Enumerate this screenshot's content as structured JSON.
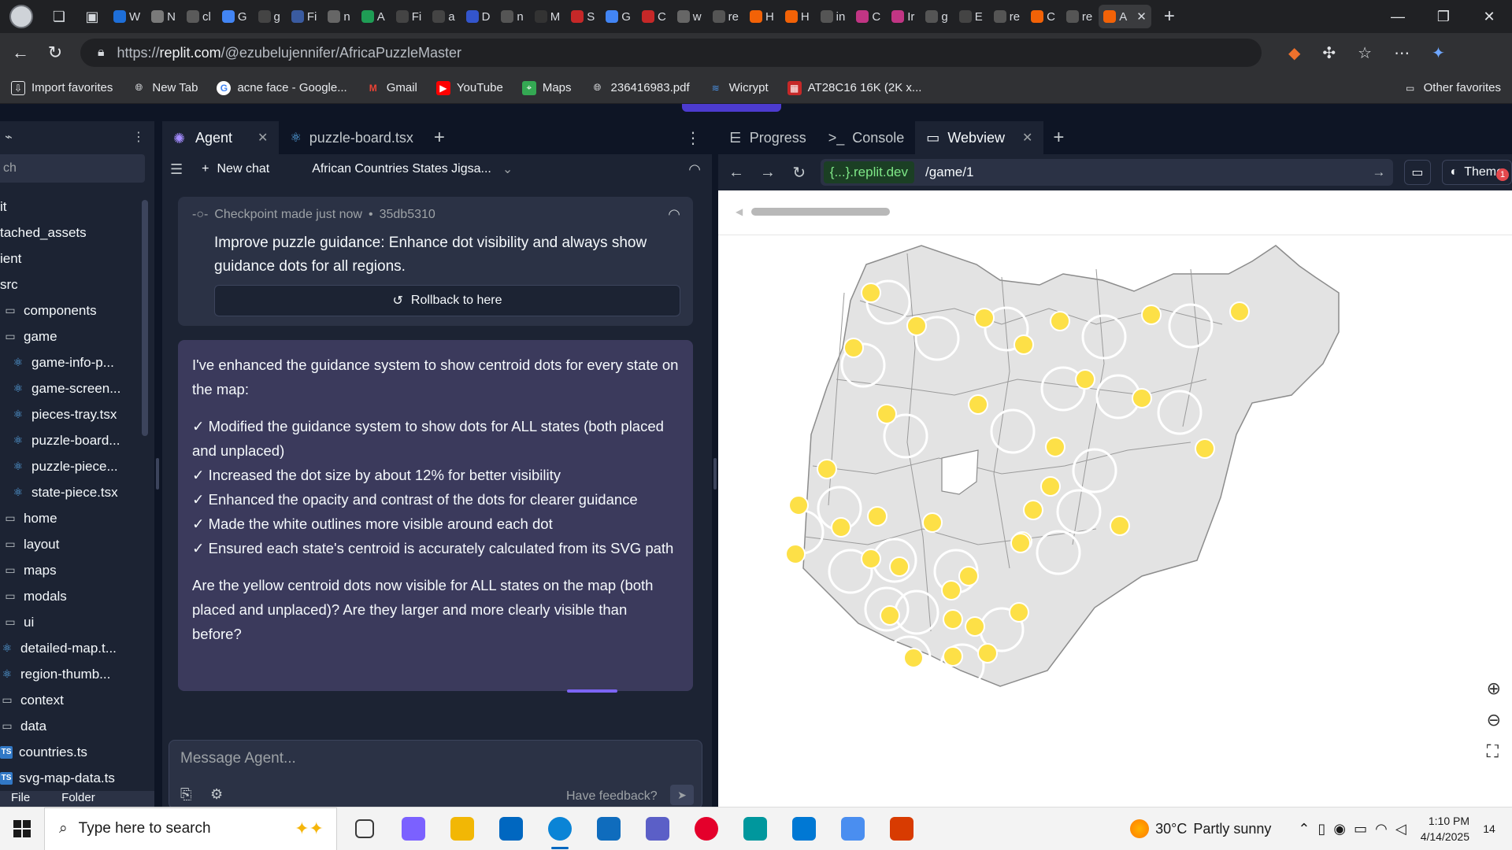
{
  "browser": {
    "url_prefix": "https://",
    "url_host": "replit.com",
    "url_path": "/@ezubelujennifer/AfricaPuzzleMaster",
    "tabs": [
      {
        "label": "W",
        "color": "#1e6fd9"
      },
      {
        "label": "N",
        "color": "#7a7a7a"
      },
      {
        "label": "cl",
        "color": "#5a5a5a"
      },
      {
        "label": "G",
        "color": "#4285f4"
      },
      {
        "label": "g",
        "color": "#444444"
      },
      {
        "label": "Fi",
        "color": "#3a5ba0"
      },
      {
        "label": "n",
        "color": "#666666"
      },
      {
        "label": "A",
        "color": "#1f9d55"
      },
      {
        "label": "Fi",
        "color": "#444444"
      },
      {
        "label": "a",
        "color": "#444444"
      },
      {
        "label": "D",
        "color": "#3355cc"
      },
      {
        "label": "n",
        "color": "#555555"
      },
      {
        "label": "M",
        "color": "#333333"
      },
      {
        "label": "S",
        "color": "#c62828"
      },
      {
        "label": "G",
        "color": "#4285f4"
      },
      {
        "label": "C",
        "color": "#c62828"
      },
      {
        "label": "w",
        "color": "#666666"
      },
      {
        "label": "re",
        "color": "#555555"
      },
      {
        "label": "H",
        "color": "#f26207"
      },
      {
        "label": "H",
        "color": "#f26207"
      },
      {
        "label": "in",
        "color": "#555555"
      },
      {
        "label": "C",
        "color": "#c13584"
      },
      {
        "label": "Ir",
        "color": "#c13584"
      },
      {
        "label": "g",
        "color": "#555555"
      },
      {
        "label": "E",
        "color": "#444444"
      },
      {
        "label": "re",
        "color": "#555555"
      },
      {
        "label": "C",
        "color": "#f26207"
      },
      {
        "label": "re",
        "color": "#555555"
      },
      {
        "label": "A",
        "color": "#f26207"
      }
    ],
    "favorites": [
      {
        "label": "Import favorites",
        "icon": "import-icon"
      },
      {
        "label": "New Tab",
        "icon": "globe-icon"
      },
      {
        "label": "acne face - Google...",
        "icon": "google-icon"
      },
      {
        "label": "Gmail",
        "icon": "gmail-icon"
      },
      {
        "label": "YouTube",
        "icon": "youtube-icon"
      },
      {
        "label": "Maps",
        "icon": "maps-icon"
      },
      {
        "label": "236416983.pdf",
        "icon": "globe-icon"
      },
      {
        "label": "Wicrypt",
        "icon": "wicrypt-icon"
      },
      {
        "label": "AT28C16 16K (2K x...",
        "icon": "site-icon"
      }
    ],
    "other_favorites": "Other favorites"
  },
  "filetree": {
    "search_placeholder": "ch",
    "items": [
      {
        "label": "it",
        "type": "file"
      },
      {
        "label": "tached_assets",
        "type": "file"
      },
      {
        "label": "ient",
        "type": "file"
      },
      {
        "label": "src",
        "type": "file"
      },
      {
        "label": "components",
        "type": "folder"
      },
      {
        "label": "game",
        "type": "folder"
      },
      {
        "label": "game-info-p...",
        "type": "react"
      },
      {
        "label": "game-screen...",
        "type": "react"
      },
      {
        "label": "pieces-tray.tsx",
        "type": "react"
      },
      {
        "label": "puzzle-board...",
        "type": "react"
      },
      {
        "label": "puzzle-piece...",
        "type": "react"
      },
      {
        "label": "state-piece.tsx",
        "type": "react"
      },
      {
        "label": "home",
        "type": "folder"
      },
      {
        "label": "layout",
        "type": "folder"
      },
      {
        "label": "maps",
        "type": "folder"
      },
      {
        "label": "modals",
        "type": "folder"
      },
      {
        "label": "ui",
        "type": "folder"
      },
      {
        "label": "detailed-map.t...",
        "type": "react"
      },
      {
        "label": "region-thumb...",
        "type": "react"
      },
      {
        "label": "context",
        "type": "folder"
      },
      {
        "label": "data",
        "type": "folder"
      },
      {
        "label": "countries.ts",
        "type": "ts"
      },
      {
        "label": "svg-map-data.ts",
        "type": "ts"
      }
    ],
    "bottom_file": "File",
    "bottom_folder": "Folder"
  },
  "agent": {
    "tab_agent": "Agent",
    "tab_file": "puzzle-board.tsx",
    "new_chat": "New chat",
    "chat_title": "African Countries States Jigsa...",
    "checkpoint_label": "Checkpoint made just now",
    "checkpoint_id": "35db5310",
    "checkpoint_text": "Improve puzzle guidance: Enhance dot visibility and always show guidance dots for all regions.",
    "rollback_label": "Rollback to here",
    "message_intro": "I've enhanced the guidance system to show centroid dots for every state on the map:",
    "message_points": [
      "✓ Modified the guidance system to show dots for ALL states (both placed and unplaced)",
      "✓ Increased the dot size by about 12% for better visibility",
      "✓ Enhanced the opacity and contrast of the dots for clearer guidance",
      "✓ Made the white outlines more visible around each dot",
      "✓ Ensured each state's centroid is accurately calculated from its SVG path"
    ],
    "message_question": "Are the yellow centroid dots now visible for ALL states on the map (both placed and unplaced)? Are they larger and more clearly visible than before?",
    "composer_placeholder": "Message Agent...",
    "feedback_label": "Have feedback?"
  },
  "webview": {
    "tab_progress": "Progress",
    "tab_console": "Console",
    "tab_webview": "Webview",
    "domain": "{...}.replit.dev",
    "path": "/game/1",
    "theme_label": "Theme",
    "notification_count": "1"
  },
  "taskbar": {
    "search_placeholder": "Type here to search",
    "weather_temp": "30°C",
    "weather_desc": "Partly sunny",
    "time": "1:10 PM",
    "date": "4/14/2025",
    "notification_count": "14",
    "apps": [
      {
        "name": "task-view-icon",
        "color": "#3a3a3a"
      },
      {
        "name": "copilot-icon",
        "color": "#7b61ff"
      },
      {
        "name": "file-explorer-icon",
        "color": "#f2b705"
      },
      {
        "name": "store-icon",
        "color": "#0067c0"
      },
      {
        "name": "edge-icon",
        "color": "#0a84d6"
      },
      {
        "name": "outlook-icon",
        "color": "#0f6cbd"
      },
      {
        "name": "m365-icon",
        "color": "#5b5fc7"
      },
      {
        "name": "opera-icon",
        "color": "#e4002b"
      },
      {
        "name": "arduino-icon",
        "color": "#00979d"
      },
      {
        "name": "vscode-icon",
        "color": "#0078d4"
      },
      {
        "name": "app-icon",
        "color": "#4a8ef0"
      },
      {
        "name": "wps-icon",
        "color": "#d83b01"
      }
    ]
  },
  "colors": {
    "dot_yellow": "#fde047",
    "map_fill": "#e3e3e3",
    "map_stroke": "#8c8c8c",
    "accent": "#7c65f6"
  }
}
